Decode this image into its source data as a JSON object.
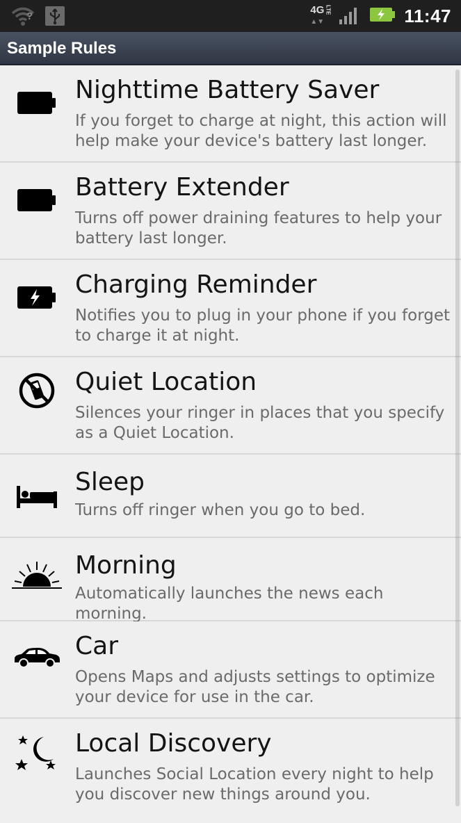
{
  "status_bar": {
    "network": "4G",
    "network_sub": "LTE",
    "time": "11:47"
  },
  "header": {
    "title": "Sample Rules"
  },
  "rules": [
    {
      "icon": "battery-icon",
      "title": "Nighttime Battery Saver",
      "description": "If you forget to charge at night, this action will help make your device's battery last longer."
    },
    {
      "icon": "battery-icon",
      "title": "Battery Extender",
      "description": "Turns off power draining features to help your battery last longer."
    },
    {
      "icon": "battery-charging-icon",
      "title": "Charging Reminder",
      "description": "Notifies you to plug in your phone if you forget to charge it at night."
    },
    {
      "icon": "no-phone-icon",
      "title": "Quiet Location",
      "description": "Silences your ringer in places that you specify as a Quiet Location."
    },
    {
      "icon": "bed-icon",
      "title": "Sleep",
      "description": "Turns off ringer when you go to bed."
    },
    {
      "icon": "sunrise-icon",
      "title": "Morning",
      "description": "Automatically launches the news each morning."
    },
    {
      "icon": "car-icon",
      "title": "Car",
      "description": "Opens Maps and adjusts settings to optimize your device for use in the car."
    },
    {
      "icon": "moon-stars-icon",
      "title": "Local Discovery",
      "description": "Launches Social Location every night to help you discover new things around you."
    }
  ]
}
